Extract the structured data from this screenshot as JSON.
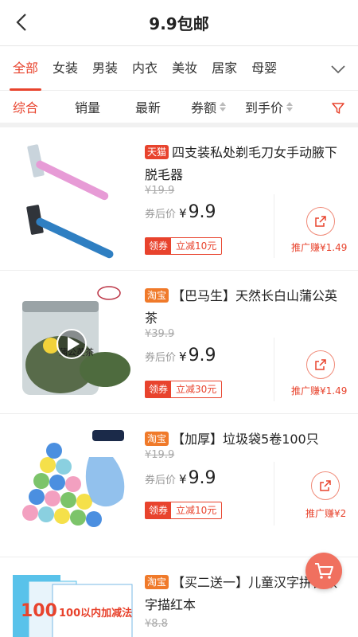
{
  "header": {
    "title": "9.9包邮"
  },
  "categories": [
    "全部",
    "女装",
    "男装",
    "内衣",
    "美妆",
    "居家",
    "母婴"
  ],
  "sorts": [
    "综合",
    "销量",
    "最新",
    "券额",
    "到手价"
  ],
  "colors": {
    "accent": "#e8432d",
    "tmall_tag": "#e8432d",
    "taobao_tag": "#f07a2a"
  },
  "items": [
    {
      "tag": "天猫",
      "title": "四支装私处剃毛刀女手动腋下脱毛器",
      "orig_price": "¥19.9",
      "after_label": "券后价",
      "yen": "¥",
      "price": "9.9",
      "coupon_label": "领券",
      "coupon_value": "立减10元",
      "earn": "推广赚¥1.49",
      "image": "pink-and-blue-razors"
    },
    {
      "tag": "淘宝",
      "title": "【巴马生】天然长白山蒲公英茶",
      "orig_price": "¥39.9",
      "after_label": "券后价",
      "yen": "¥",
      "price": "9.9",
      "coupon_label": "领券",
      "coupon_value": "立减30元",
      "earn": "推广赚¥1.49",
      "image": "dandelion-tea-jar",
      "jar_label": "蒲公英茶"
    },
    {
      "tag": "淘宝",
      "title": "【加厚】垃圾袋5卷100只",
      "orig_price": "¥19.9",
      "after_label": "券后价",
      "yen": "¥",
      "price": "9.9",
      "coupon_label": "领券",
      "coupon_value": "立减10元",
      "earn": "推广赚¥2",
      "image": "colorful-garbage-bag-rolls"
    },
    {
      "tag": "淘宝",
      "title": "【买二送一】儿童汉字拼音数字描红本",
      "orig_price": "¥8.8",
      "image": "kids-workbooks",
      "book_text": "100以内加减法",
      "book_num": "100"
    }
  ]
}
